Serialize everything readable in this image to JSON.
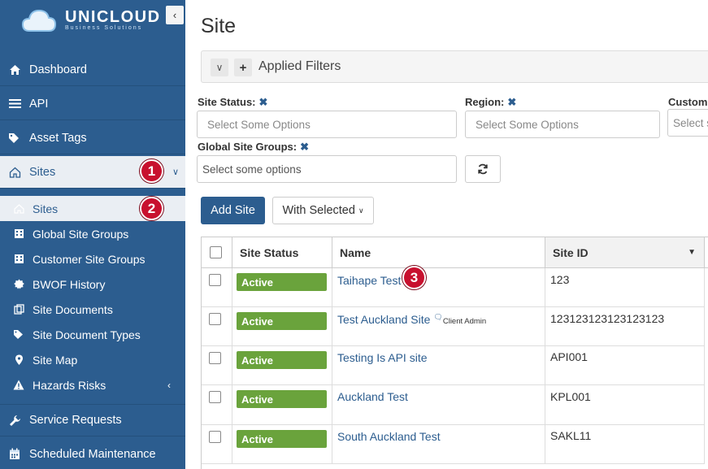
{
  "brand": {
    "name": "UNICLOUD",
    "tagline": "Business Solutions"
  },
  "sidebar": {
    "items": [
      {
        "label": "Dashboard",
        "icon": "home-icon"
      },
      {
        "label": "API",
        "icon": "menu-icon"
      },
      {
        "label": "Asset Tags",
        "icon": "tags-icon"
      },
      {
        "label": "Sites",
        "icon": "home-outline-icon",
        "expanded": true
      }
    ],
    "sub_items": [
      {
        "label": "Sites",
        "icon": "home-outline-icon",
        "active": true
      },
      {
        "label": "Global Site Groups",
        "icon": "building-icon"
      },
      {
        "label": "Customer Site Groups",
        "icon": "building-icon"
      },
      {
        "label": "BWOF History",
        "icon": "badge-icon"
      },
      {
        "label": "Site Documents",
        "icon": "copy-icon"
      },
      {
        "label": "Site Document Types",
        "icon": "tags-icon"
      },
      {
        "label": "Site Map",
        "icon": "map-marker-icon"
      },
      {
        "label": "Hazards Risks",
        "icon": "warning-icon"
      }
    ],
    "bottom_items": [
      {
        "label": "Service Requests",
        "icon": "wrench-icon"
      },
      {
        "label": "Scheduled Maintenance",
        "icon": "calendar-icon"
      }
    ]
  },
  "annotations": [
    "1",
    "2",
    "3"
  ],
  "page": {
    "title": "Site"
  },
  "filters": {
    "bar_label": "Applied Filters",
    "site_status_label": "Site Status:",
    "region_label": "Region:",
    "customer_label": "Custom",
    "global_groups_label": "Global Site Groups:",
    "site_status_placeholder": "Select Some Options",
    "region_placeholder": "Select Some Options",
    "customer_placeholder": "Select s",
    "global_groups_placeholder": "Select some options"
  },
  "actions": {
    "add_site": "Add Site",
    "with_selected": "With Selected"
  },
  "table": {
    "headers": {
      "status": "Site Status",
      "name": "Name",
      "site_id": "Site ID"
    },
    "rows": [
      {
        "status": "Active",
        "name": "Taihape Test",
        "tag": "",
        "site_id": "123"
      },
      {
        "status": "Active",
        "name": "Test Auckland Site",
        "tag": "Client Admin",
        "site_id": "123123123123123123"
      },
      {
        "status": "Active",
        "name": "Testing Is API site",
        "tag": "",
        "site_id": "API001"
      },
      {
        "status": "Active",
        "name": "Auckland Test",
        "tag": "",
        "site_id": "KPL001"
      },
      {
        "status": "Active",
        "name": "South Auckland Test",
        "tag": "",
        "site_id": "SAKL11"
      }
    ]
  },
  "colors": {
    "sidebar": "#2c5d8f",
    "status_active": "#6aa33c",
    "badge": "#c8102e",
    "link": "#2c5d8f"
  }
}
